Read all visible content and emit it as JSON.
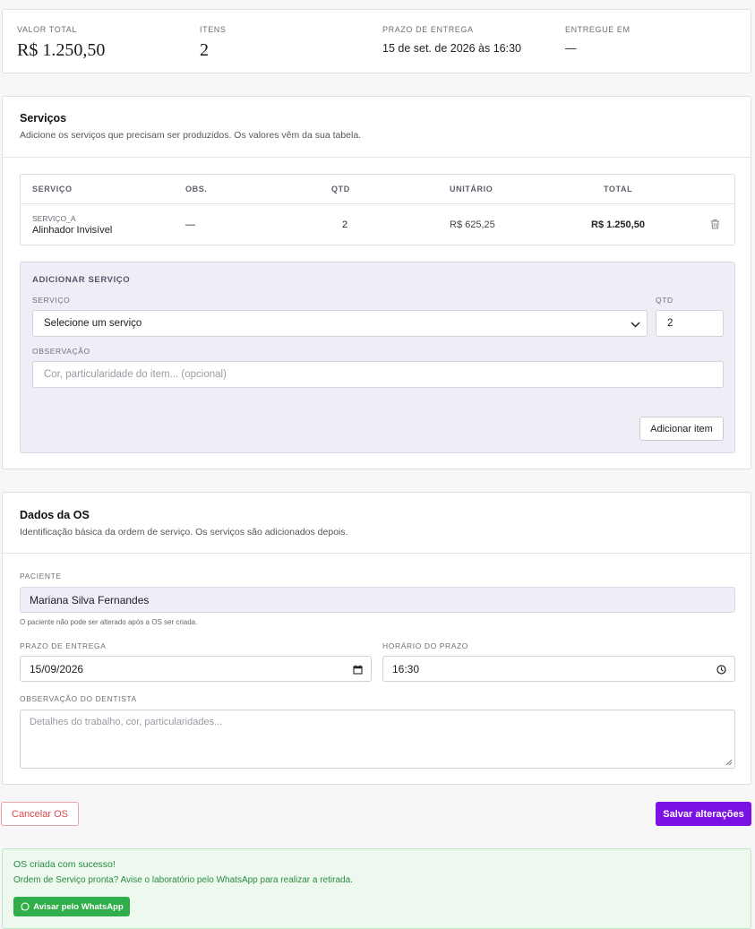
{
  "summary": {
    "total_label": "VALOR TOTAL",
    "total_value": "R$ 1.250,50",
    "items_label": "ITENS",
    "items_value": "2",
    "deadline_label": "PRAZO DE ENTREGA",
    "deadline_value": "15 de set. de 2026 às 16:30",
    "delivered_label": "ENTREGUE EM",
    "delivered_value": "—"
  },
  "services": {
    "title": "Serviços",
    "subtitle": "Adicione os serviços que precisam ser produzidos. Os valores vêm da sua tabela.",
    "columns": [
      "SERVIÇO",
      "OBS.",
      "QTD",
      "UNITÁRIO",
      "TOTAL"
    ],
    "rows": [
      {
        "code": "SERVIÇO_A",
        "name": "Alinhador Invisível",
        "obs": "—",
        "qty": "2",
        "unit": "R$ 625,25",
        "total": "R$ 1.250,50"
      }
    ],
    "add": {
      "heading": "ADICIONAR SERVIÇO",
      "service_label": "SERVIÇO",
      "service_selected": "Selecione um serviço",
      "qty_label": "QTD",
      "qty_value": "2",
      "obs_label": "OBSERVAÇÃO",
      "obs_placeholder": "Cor, particularidade do item... (opcional)",
      "button": "Adicionar item"
    }
  },
  "os": {
    "title": "Dados da OS",
    "subtitle": "Identificação básica da ordem de serviço. Os serviços são adicionados depois.",
    "patient_label": "PACIENTE",
    "patient_value": "Mariana Silva Fernandes",
    "patient_hint": "O paciente não pode ser alterado após a OS ser criada.",
    "deadline_label": "PRAZO DE ENTREGA",
    "deadline_value": "15/09/2026",
    "time_label": "HORÁRIO DO PRAZO",
    "time_value": "16:30",
    "notes_label": "OBSERVAÇÃO DO DENTISTA",
    "notes_placeholder": "Detalhes do trabalho, cor, particularidades..."
  },
  "actions": {
    "cancel": "Cancelar OS",
    "save": "Salvar alterações"
  },
  "success": {
    "title": "OS criada com sucesso!",
    "message": "Ordem de Serviço pronta? Avise o laboratório pelo WhatsApp para realizar a retirada.",
    "button": "Avisar pelo WhatsApp"
  },
  "colors": {
    "accent": "#7a12e6",
    "danger": "#e0565b",
    "success": "#2fae4a"
  },
  "icons": [
    "trash-icon",
    "chevron-down-icon",
    "calendar-icon",
    "clock-icon",
    "whatsapp-icon",
    "resize-handle-icon"
  ]
}
